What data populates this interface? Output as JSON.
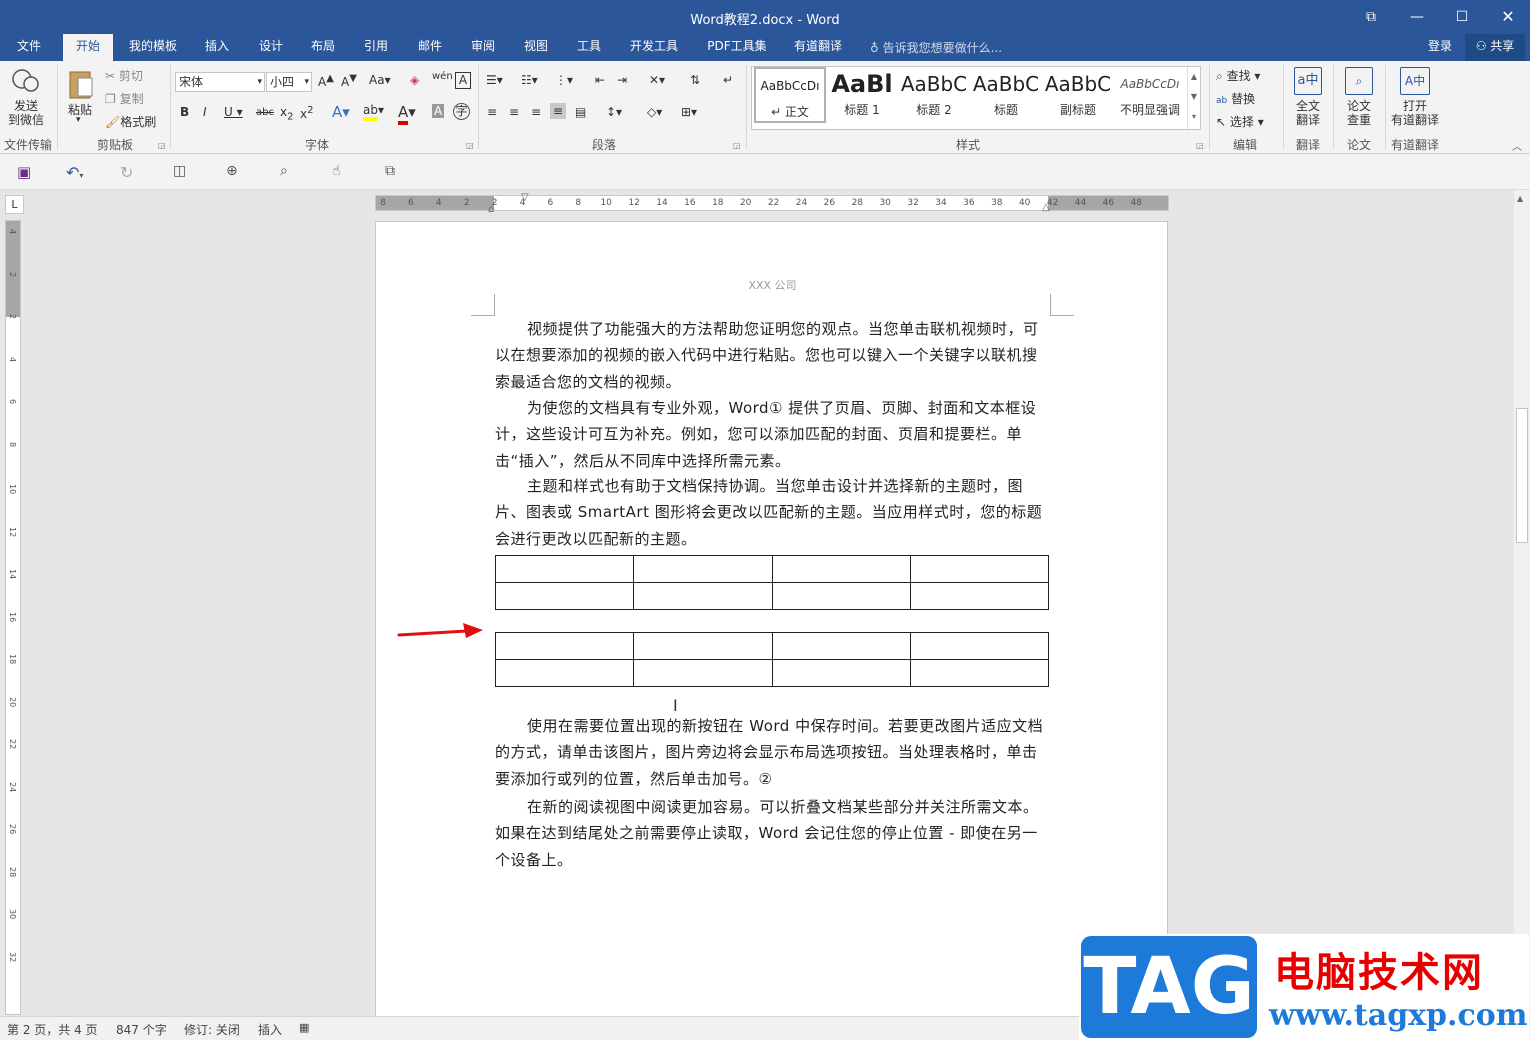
{
  "window": {
    "title": "Word教程2.docx - Word"
  },
  "tabs": [
    "文件",
    "开始",
    "我的模板",
    "插入",
    "设计",
    "布局",
    "引用",
    "邮件",
    "审阅",
    "视图",
    "工具",
    "开发工具",
    "PDF工具集",
    "有道翻译"
  ],
  "tellme": "告诉我您想要做什么...",
  "account": {
    "login": "登录",
    "share": "共享"
  },
  "ribbon": {
    "send_wechat": "发送\n到微信",
    "file_transfer": "文件传输",
    "paste": "粘贴",
    "cut": "剪切",
    "copy": "复制",
    "format_painter": "格式刷",
    "clipboard": "剪贴板",
    "font_name": "宋体",
    "font_size": "小四",
    "font_group": "字体",
    "paragraph_group": "段落",
    "styles_group": "样式",
    "styles": [
      {
        "preview": "AaBbCcDı",
        "name": "↵ 正文"
      },
      {
        "preview": "AaBl",
        "name": "标题 1"
      },
      {
        "preview": "AaBbC",
        "name": "标题 2"
      },
      {
        "preview": "AaBbC",
        "name": "标题"
      },
      {
        "preview": "AaBbC",
        "name": "副标题"
      },
      {
        "preview": "AaBbCcDı",
        "name": "不明显强调"
      }
    ],
    "find": "查找",
    "replace": "替换",
    "select": "选择",
    "edit_group": "编辑",
    "full_translate": "全文\n翻译",
    "translate_group": "翻译",
    "paper_check": "论文\n查重",
    "paper_group": "论文",
    "open_youdao": "打开\n有道翻译",
    "youdao_group": "有道翻译"
  },
  "ruler": {
    "ticks": [
      "8",
      "6",
      "4",
      "2",
      "2",
      "4",
      "6",
      "8",
      "10",
      "12",
      "14",
      "16",
      "18",
      "20",
      "22",
      "24",
      "26",
      "28",
      "30",
      "32",
      "34",
      "36",
      "38",
      "40",
      "42",
      "44",
      "46",
      "48"
    ],
    "vticks": [
      "4",
      "2",
      "2",
      "4",
      "6",
      "8",
      "10",
      "12",
      "14",
      "16",
      "18",
      "20",
      "22",
      "24",
      "26",
      "28",
      "30",
      "32"
    ]
  },
  "document": {
    "header": "XXX 公司",
    "paragraphs": [
      "视频提供了功能强大的方法帮助您证明您的观点。当您单击联机视频时，可以在想要添加的视频的嵌入代码中进行粘贴。您也可以键入一个关键字以联机搜索最适合您的文档的视频。",
      "为使您的文档具有专业外观，Word① 提供了页眉、页脚、封面和文本框设计，这些设计可互为补充。例如，您可以添加匹配的封面、页眉和提要栏。单击“插入”，然后从不同库中选择所需元素。",
      "主题和样式也有助于文档保持协调。当您单击设计并选择新的主题时，图片、图表或 SmartArt 图形将会更改以匹配新的主题。当应用样式时，您的标题会进行更改以匹配新的主题。",
      "使用在需要位置出现的新按钮在 Word 中保存时间。若要更改图片适应文档的方式，请单击该图片，图片旁边将会显示布局选项按钮。当处理表格时，单击要添加行或列的位置，然后单击加号。②",
      "在新的阅读视图中阅读更加容易。可以折叠文档某些部分并关注所需文本。如果在达到结尾处之前需要停止读取，Word 会记住您的停止位置 - 即使在另一个设备上。"
    ]
  },
  "status": {
    "page": "第 2 页，共 4 页",
    "words": "847 个字",
    "track": "修订: 关闭",
    "mode": "插入"
  },
  "watermark": {
    "tag": "TAG",
    "site_cn": "电脑技术网",
    "url": "www.tagxp.com"
  },
  "colors": {
    "accent": "#2b579a",
    "arrow": "#e01010",
    "wm_blue": "#1e7ad9",
    "wm_red": "#e60000"
  }
}
